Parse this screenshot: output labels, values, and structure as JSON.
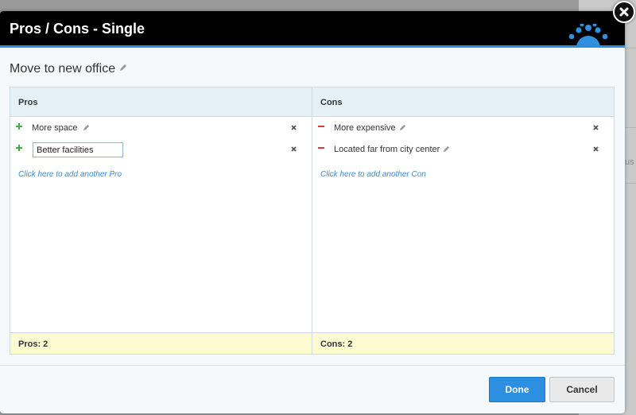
{
  "dialog": {
    "title": "Pros / Cons - Single",
    "decision": "Move to new office"
  },
  "pros": {
    "header": "Pros",
    "items": [
      {
        "text": "More space"
      },
      {
        "value": "Better facilities"
      }
    ],
    "add_link": "Click here to add another Pro",
    "footer": "Pros: 2"
  },
  "cons": {
    "header": "Cons",
    "items": [
      {
        "text": "More expensive"
      },
      {
        "text": "Located far from city center"
      }
    ],
    "add_link": "Click here to add another Con",
    "footer": "Cons: 2"
  },
  "buttons": {
    "done": "Done",
    "cancel": "Cancel"
  },
  "background": {
    "partial_text": "us"
  },
  "colors": {
    "accent": "#2d8fe0",
    "pro_sign": "#3cb043",
    "con_sign": "#e03a2f",
    "summary_bg": "#fdfbd2"
  }
}
